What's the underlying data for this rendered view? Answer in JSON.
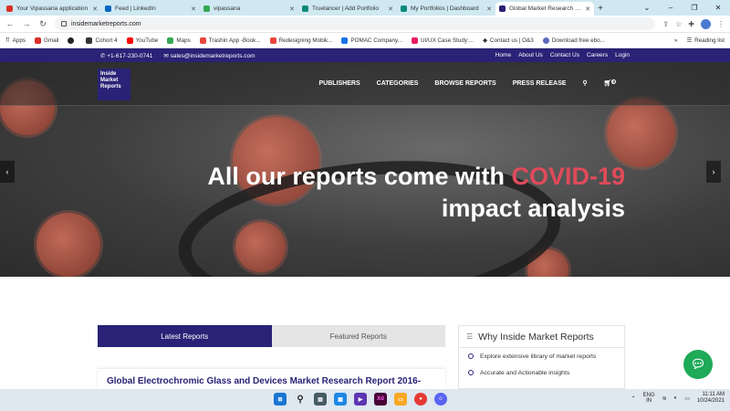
{
  "browser": {
    "tabs": [
      {
        "title": "Your Vipassana application",
        "color": "#d93025"
      },
      {
        "title": "Feed | LinkedIn",
        "color": "#0a66c2"
      },
      {
        "title": "vipassana",
        "color": "#34a853"
      },
      {
        "title": "Truelancer | Add Portfolio",
        "color": "#0b8a7a"
      },
      {
        "title": "My Portfolios | Dashboard",
        "color": "#0b8a7a"
      },
      {
        "title": "Global Market Research Re",
        "color": "#2a2276"
      }
    ],
    "new_tab": "+",
    "url": "insidemarketreports.com",
    "bookmarks": [
      {
        "label": "Apps",
        "color": "#777"
      },
      {
        "label": "Gmail",
        "color": "#d93025"
      },
      {
        "label": "",
        "color": "#222"
      },
      {
        "label": "Cohort 4",
        "color": "#333"
      },
      {
        "label": "YouTube",
        "color": "#ff0000"
      },
      {
        "label": "Maps",
        "color": "#34a853"
      },
      {
        "label": "Trashin App -Book...",
        "color": "#e8453c"
      },
      {
        "label": "Redesigning Mobik...",
        "color": "#e8453c"
      },
      {
        "label": "POMAC Company...",
        "color": "#1a73e8"
      },
      {
        "label": "UI/UX Case Study:...",
        "color": "#e91e63"
      },
      {
        "label": "Contact us | O&3",
        "color": "#555"
      },
      {
        "label": "Download free ebo...",
        "color": "#5c6bc0"
      }
    ],
    "reading_list": "Reading list"
  },
  "site": {
    "phone": "+1-617-230-0741",
    "email": "sales@insidemarketreports.com",
    "top_links": [
      "Home",
      "About Us",
      "Contact Us",
      "Careers",
      "Login"
    ],
    "logo_lines": [
      "Inside",
      "Market",
      "Reports"
    ],
    "menu": [
      "PUBLISHERS",
      "CATEGORIES",
      "BROWSE REPORTS",
      "PRESS RELEASE"
    ],
    "cart_count": "0",
    "hero_line1_a": "All our reports come with ",
    "hero_line1_b": "COVID-19",
    "hero_line2": "impact analysis",
    "tab_latest": "Latest Reports",
    "tab_featured": "Featured Reports",
    "report_title": "Global Electrochromic Glass and Devices Market Research Report 2016-",
    "why_title": "Why Inside Market Reports",
    "why_items": [
      "Explore extensive library of market reports",
      "Accurate and Actionable insights"
    ]
  },
  "taskbar": {
    "lang_1": "ENG",
    "lang_2": "IN",
    "time": "11:11 AM",
    "date": "10/24/2021"
  }
}
